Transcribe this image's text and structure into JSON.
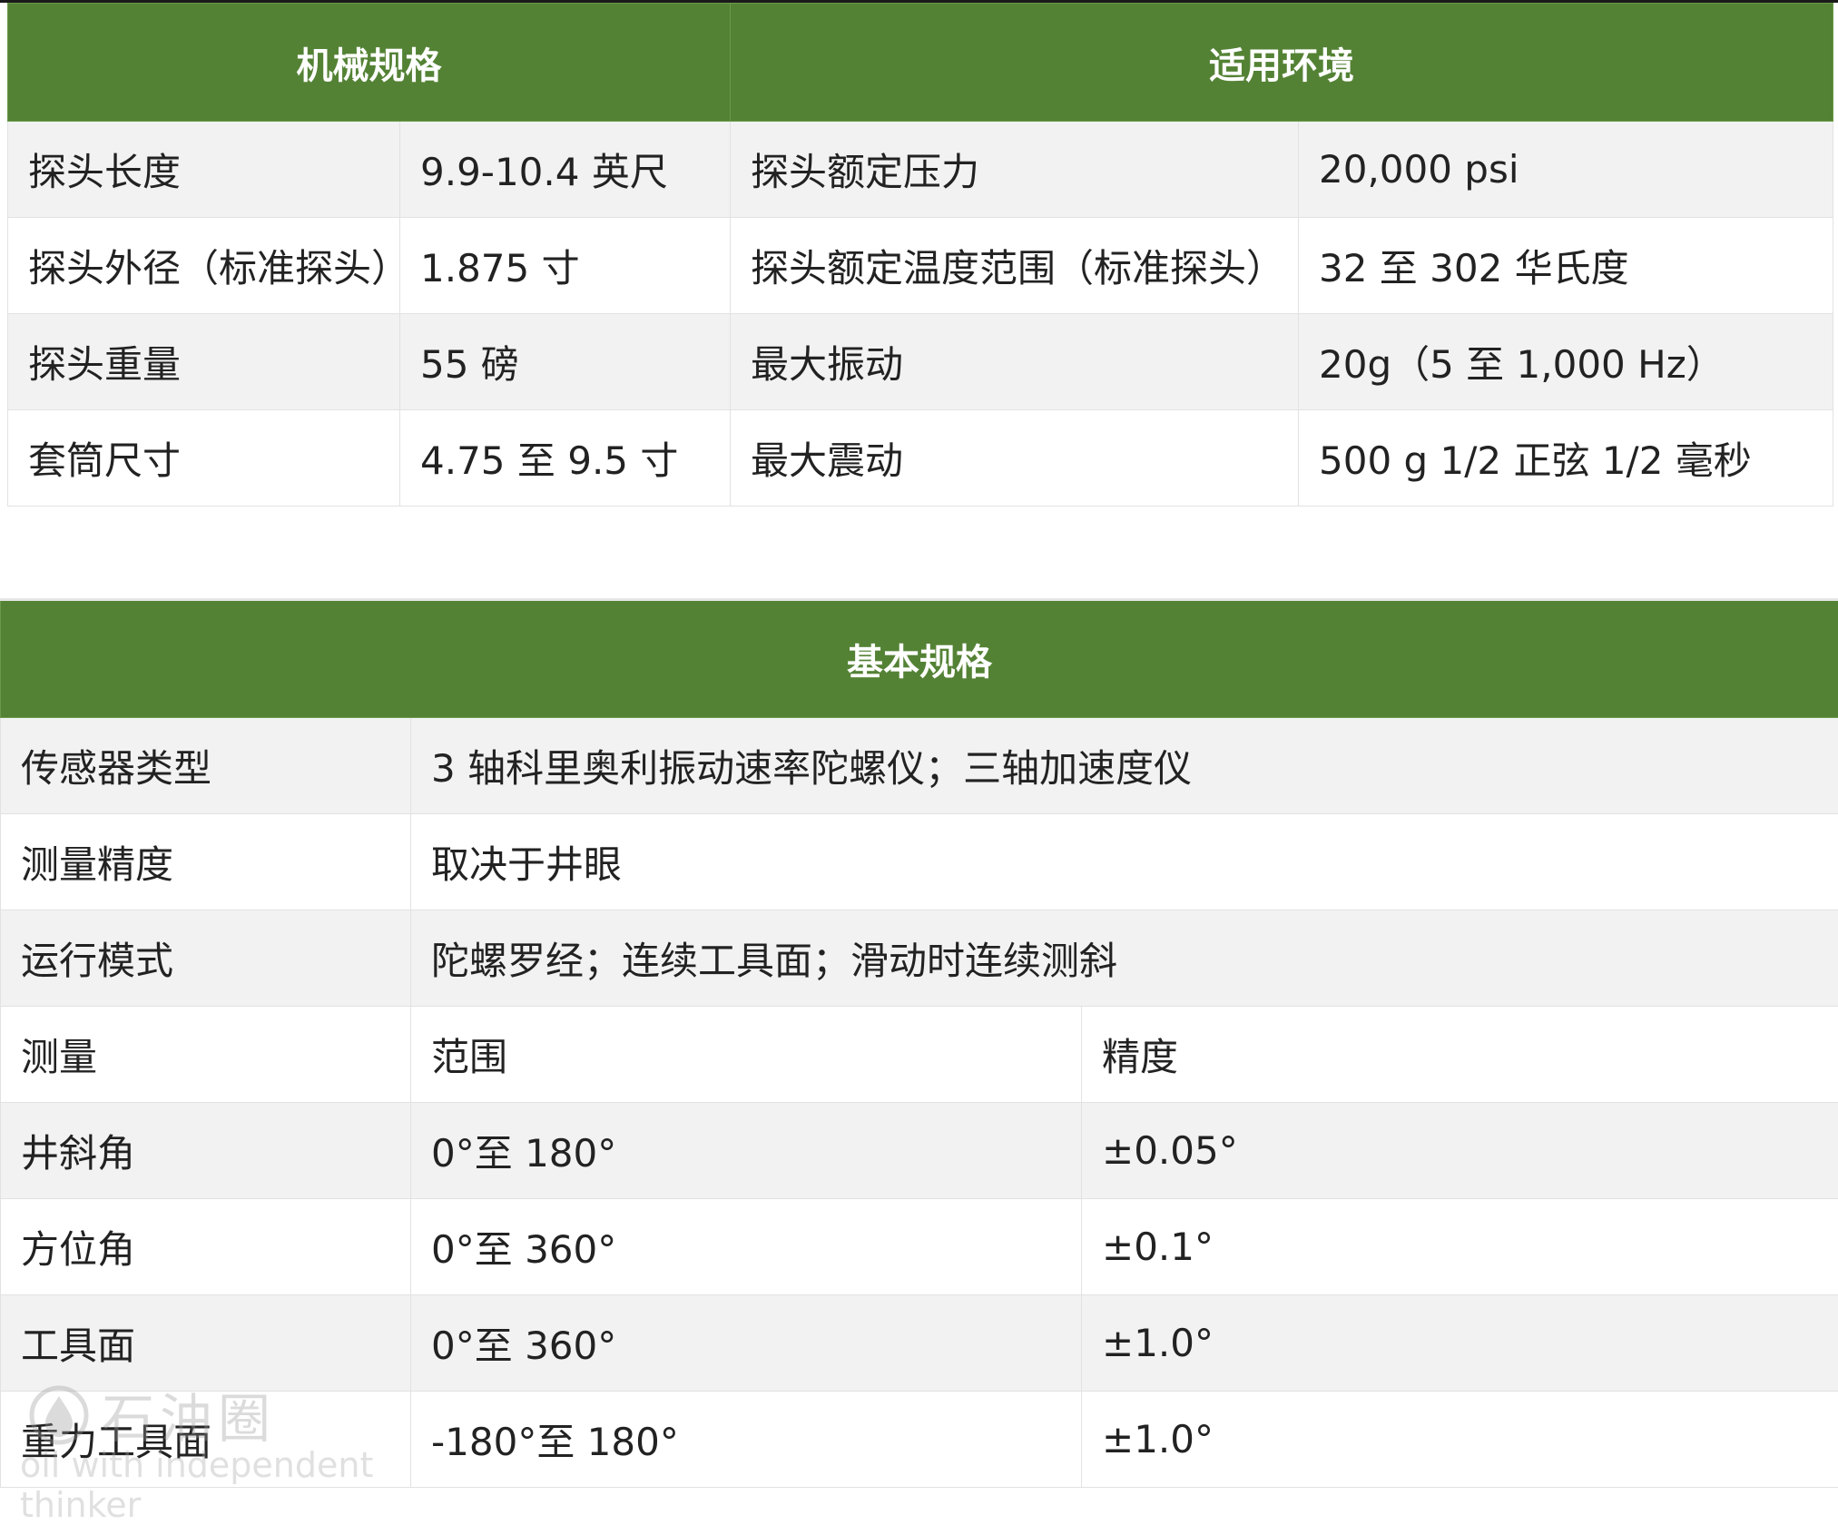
{
  "colors": {
    "header_bg": "#548235",
    "row_shade": "#f2f2f2",
    "border": "#e2e2e2"
  },
  "mechanical": {
    "header_left": "机械规格",
    "header_right": "适用环境",
    "rows": [
      {
        "label1": "探头长度",
        "value1": "9.9-10.4 英尺",
        "label2": "探头额定压力",
        "value2": "20,000 psi"
      },
      {
        "label1": "探头外径（标准探头）",
        "value1": "1.875 寸",
        "label2": "探头额定温度范围（标准探头）",
        "value2": "32 至 302 华氏度"
      },
      {
        "label1": "探头重量",
        "value1": "55 磅",
        "label2": "最大振动",
        "value2": "20g（5 至 1,000 Hz）"
      },
      {
        "label1": "套筒尺寸",
        "value1": "4.75 至 9.5 寸",
        "label2": "最大震动",
        "value2": "500 g 1/2 正弦 1/2 毫秒"
      }
    ]
  },
  "basic": {
    "header": "基本规格",
    "rows": [
      {
        "label": "传感器类型",
        "value": "3 轴科里奥利振动速率陀螺仪；三轴加速度仪"
      },
      {
        "label": "测量精度",
        "value": "取决于井眼"
      },
      {
        "label": "运行模式",
        "value": "陀螺罗经；连续工具面；滑动时连续测斜"
      }
    ],
    "measure_header": {
      "c1": "测量",
      "c2": "范围",
      "c3": "精度"
    },
    "measure_rows": [
      {
        "c1": "井斜角",
        "c2": "0°至 180°",
        "c3": "±0.05°"
      },
      {
        "c1": "方位角",
        "c2": "0°至  360°",
        "c3": "±0.1°"
      },
      {
        "c1": "工具面",
        "c2": "0°至 360°",
        "c3": "±1.0°"
      },
      {
        "c1": "重力工具面",
        "c2": "-180°至 180°",
        "c3": "±1.0°"
      }
    ]
  },
  "watermark": {
    "title": "石油圈",
    "subtitle": "oil with independent thinker",
    "icon": "oil-drop-icon"
  }
}
